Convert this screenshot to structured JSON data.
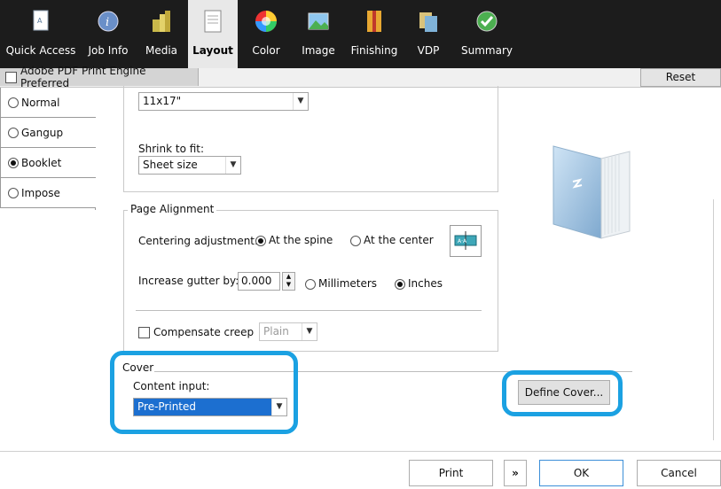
{
  "tabs": [
    {
      "label": "Quick Access",
      "icon": "quick-access-icon"
    },
    {
      "label": "Job Info",
      "icon": "job-info-icon"
    },
    {
      "label": "Media",
      "icon": "media-icon"
    },
    {
      "label": "Layout",
      "icon": "layout-icon",
      "active": true
    },
    {
      "label": "Color",
      "icon": "color-wheel-icon"
    },
    {
      "label": "Image",
      "icon": "image-icon"
    },
    {
      "label": "Finishing",
      "icon": "finishing-icon"
    },
    {
      "label": "VDP",
      "icon": "vdp-icon"
    },
    {
      "label": "Summary",
      "icon": "summary-check-icon"
    }
  ],
  "toolbar": {
    "pdf_engine_label": "Adobe PDF Print Engine Preferred",
    "reset_label": "Reset"
  },
  "layout_modes": [
    {
      "label": "Normal",
      "selected": false
    },
    {
      "label": "Gangup",
      "selected": false
    },
    {
      "label": "Booklet",
      "selected": true
    },
    {
      "label": "Impose",
      "selected": false
    }
  ],
  "booklet": {
    "paper_size_value": "11x17\"",
    "shrink_label": "Shrink to fit:",
    "shrink_value": "Sheet size"
  },
  "page_alignment": {
    "title": "Page Alignment",
    "centering_label": "Centering adjustment:",
    "centering_options": [
      "At the spine",
      "At the center"
    ],
    "centering_selected": "At the spine",
    "gutter_label": "Increase gutter by:",
    "gutter_value": "0.000",
    "unit_options": [
      "Millimeters",
      "Inches"
    ],
    "unit_selected": "Inches",
    "creep_label": "Compensate creep",
    "creep_value": "Plain"
  },
  "cover": {
    "title": "Cover",
    "content_input_label": "Content input:",
    "content_input_value": "Pre-Printed",
    "define_cover_label": "Define Cover..."
  },
  "footer": {
    "print_label": "Print",
    "more_label": "»",
    "ok_label": "OK",
    "cancel_label": "Cancel"
  },
  "colors": {
    "highlight": "#1ba1e2",
    "selected_input": "#1c6fd0",
    "topbar": "#1c1c1c"
  }
}
